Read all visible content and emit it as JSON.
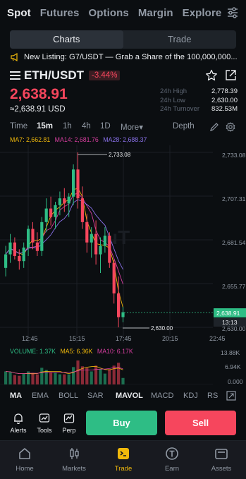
{
  "topnav": {
    "items": [
      "Spot",
      "Futures",
      "Options",
      "Margin",
      "Explore"
    ],
    "active": "Spot",
    "filter_icon": "sliders-icon"
  },
  "segment": {
    "charts": "Charts",
    "trade": "Trade",
    "active": "Charts"
  },
  "ticker": {
    "icon": "megaphone-icon",
    "text": "New Listing: G7/USDT — Grab a Share of the 100,000,000..."
  },
  "pair": {
    "symbol": "ETH/USDT",
    "change": "-3.44%",
    "price": "2,638.91",
    "fiat": "≈2,638.91 USD"
  },
  "stats": [
    {
      "label": "24h High",
      "value": "2,778.39"
    },
    {
      "label": "24h Low",
      "value": "2,630.00"
    },
    {
      "label": "24h Turnover",
      "value": "832.53M"
    }
  ],
  "timeframes": {
    "items": [
      "Time",
      "15m",
      "1h",
      "4h",
      "1D",
      "More▾",
      "Depth"
    ],
    "active": "15m"
  },
  "ma_legend": {
    "ma7": "MA7: 2,662.81",
    "ma14": "MA14: 2,681.76",
    "ma28": "MA28: 2,688.37"
  },
  "chart_axis": {
    "y_labels": [
      "2,733.08",
      "2,707.31",
      "2,681.54",
      "2,655.77",
      "2,630.00"
    ],
    "x_labels": [
      "12:45",
      "15:15",
      "17:45",
      "20:15",
      "22:45"
    ],
    "current_price_tag": "2,638.91",
    "countdown": "13:13",
    "high_label": "2,733.08",
    "low_label": "2,630.00",
    "current_price": 2638.91,
    "watermark": "uT"
  },
  "chart_data": {
    "type": "candlestick",
    "y_range": [
      2630.0,
      2733.08
    ],
    "candles": [
      [
        2665,
        2678,
        2660,
        2673
      ],
      [
        2673,
        2685,
        2668,
        2680
      ],
      [
        2680,
        2683,
        2670,
        2672
      ],
      [
        2672,
        2676,
        2664,
        2669
      ],
      [
        2669,
        2680,
        2665,
        2677
      ],
      [
        2677,
        2690,
        2672,
        2688
      ],
      [
        2688,
        2692,
        2676,
        2680
      ],
      [
        2680,
        2686,
        2672,
        2675
      ],
      [
        2675,
        2695,
        2672,
        2692
      ],
      [
        2692,
        2706,
        2686,
        2700
      ],
      [
        2700,
        2707,
        2690,
        2695
      ],
      [
        2695,
        2704,
        2688,
        2702
      ],
      [
        2702,
        2710,
        2696,
        2706
      ],
      [
        2706,
        2712,
        2698,
        2703
      ],
      [
        2703,
        2709,
        2695,
        2707
      ],
      [
        2707,
        2726,
        2702,
        2723
      ],
      [
        2723,
        2733.08,
        2700,
        2706
      ],
      [
        2706,
        2713,
        2688,
        2692
      ],
      [
        2692,
        2697,
        2674,
        2680
      ],
      [
        2680,
        2689,
        2671,
        2685
      ],
      [
        2685,
        2693,
        2667,
        2673
      ],
      [
        2673,
        2683,
        2662,
        2678
      ],
      [
        2678,
        2689,
        2674,
        2684
      ],
      [
        2684,
        2686,
        2665,
        2668
      ],
      [
        2668,
        2670,
        2644,
        2650
      ],
      [
        2650,
        2660,
        2630.0,
        2636
      ],
      [
        2636,
        2642,
        2633,
        2638.91
      ]
    ],
    "ma_legend_colors": {
      "ma7": "#f0b90b",
      "ma14": "#d63e9f",
      "ma28": "#8a71ea"
    }
  },
  "volume": {
    "vol": "VOLUME: 1.37K",
    "ma5": "MA5: 6.36K",
    "ma10": "MA10: 6.17K",
    "y_labels": [
      "13.88K",
      "6.94K",
      "0.000"
    ]
  },
  "indicators": {
    "items": [
      "MA",
      "EMA",
      "BOLL",
      "SAR",
      "MAVOL",
      "MACD",
      "KDJ",
      "RS"
    ],
    "active": [
      "MA",
      "MAVOL"
    ]
  },
  "toolbar": {
    "alerts": "Alerts",
    "tools": "Tools",
    "perp": "Perp",
    "buy": "Buy",
    "sell": "Sell"
  },
  "tabbar": {
    "items": [
      {
        "label": "Home",
        "icon": "home-icon"
      },
      {
        "label": "Markets",
        "icon": "candles-icon"
      },
      {
        "label": "Trade",
        "icon": "trade-icon"
      },
      {
        "label": "Earn",
        "icon": "earn-icon"
      },
      {
        "label": "Assets",
        "icon": "wallet-icon"
      }
    ],
    "active": "Trade"
  },
  "colors": {
    "up": "#2ebd85",
    "down": "#f6465d",
    "accent": "#f0b90b",
    "bg": "#0b0e11"
  }
}
